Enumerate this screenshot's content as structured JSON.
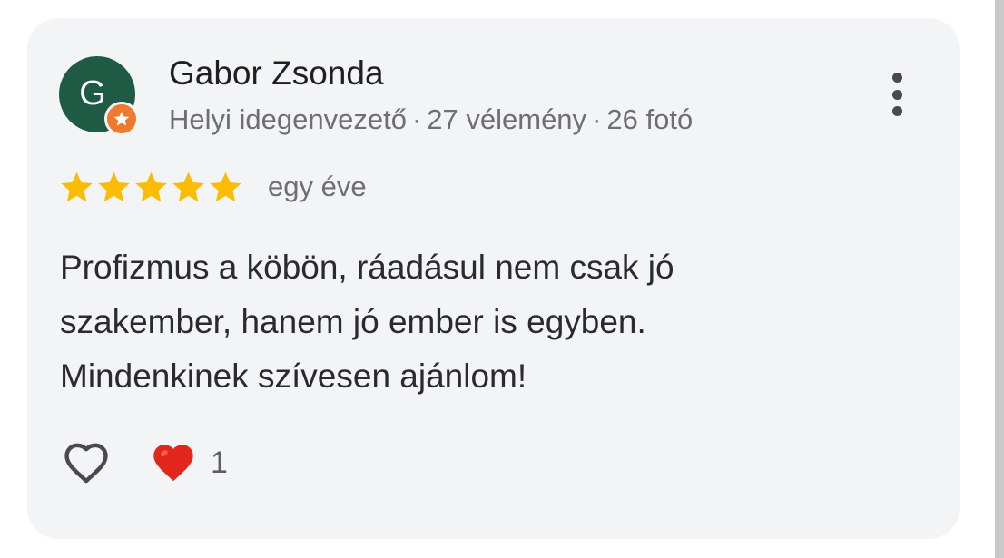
{
  "review": {
    "author": {
      "avatar_letter": "G",
      "name": "Gabor Zsonda",
      "role": "Helyi idegenvezető",
      "reviews": "27 vélemény",
      "photos": "26 fotó",
      "meta_separator": "·"
    },
    "rating": 5,
    "rating_max": 5,
    "time": "egy éve",
    "text_lines": [
      "Profizmus a köbön, ráadásul nem csak jó",
      "szakember, hanem jó ember is egyben.",
      "Mindenkinek szívesen ajánlom!"
    ],
    "reactions": {
      "heart_count": "1"
    }
  },
  "icons": {
    "avatar_badge": "local-guide-star-icon",
    "more": "more-vertical-icon",
    "star": "star-icon",
    "like": "heart-outline-icon",
    "reaction": "red-heart-icon"
  },
  "colors": {
    "card_background": "#f3f4f6",
    "avatar_background": "#1f5a45",
    "badge": "#ee7a2f",
    "star": "#fbbc04",
    "heart": "#e1261c",
    "primary_text": "#1f1f1f",
    "secondary_text": "#6f6f73"
  }
}
